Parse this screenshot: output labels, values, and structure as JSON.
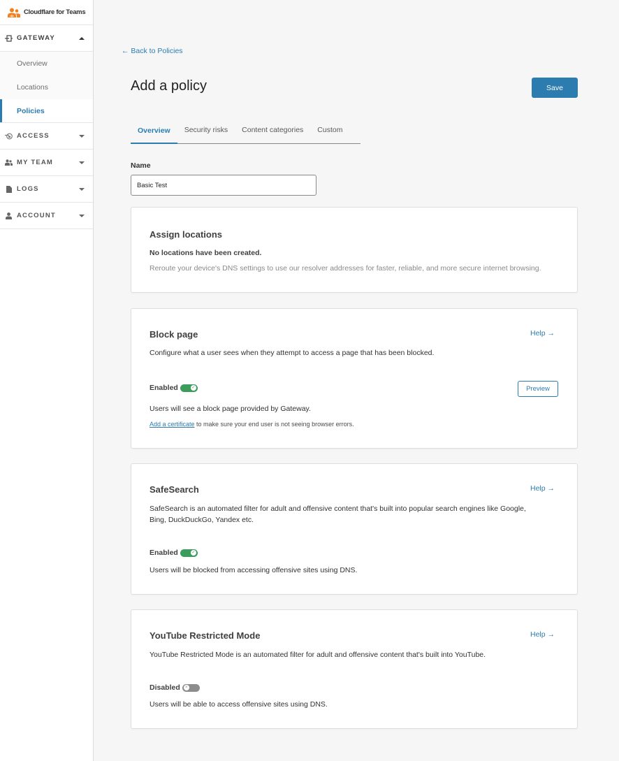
{
  "brand": {
    "name": "Cloudflare for Teams",
    "accent": "#f38020"
  },
  "sidebar": {
    "sections": [
      {
        "key": "gateway",
        "label": "GATEWAY",
        "icon": "gateway-icon",
        "expanded": true,
        "items": [
          {
            "label": "Overview",
            "active": false
          },
          {
            "label": "Locations",
            "active": false
          },
          {
            "label": "Policies",
            "active": true
          }
        ]
      },
      {
        "key": "access",
        "label": "ACCESS",
        "icon": "access-icon",
        "expanded": false
      },
      {
        "key": "my-team",
        "label": "MY TEAM",
        "icon": "team-icon",
        "expanded": false
      },
      {
        "key": "logs",
        "label": "LOGS",
        "icon": "document-icon",
        "expanded": false
      },
      {
        "key": "account",
        "label": "ACCOUNT",
        "icon": "user-icon",
        "expanded": false
      }
    ]
  },
  "header": {
    "back_link": "Back to Policies",
    "title": "Add a policy",
    "save_label": "Save"
  },
  "tabs": [
    {
      "label": "Overview",
      "active": true
    },
    {
      "label": "Security risks",
      "active": false
    },
    {
      "label": "Content categories",
      "active": false
    },
    {
      "label": "Custom",
      "active": false
    }
  ],
  "name_field": {
    "label": "Name",
    "value": "Basic Test"
  },
  "cards": {
    "assign_locations": {
      "title": "Assign locations",
      "subtitle": "No locations have been created.",
      "description": "Reroute your device's DNS settings to use our resolver addresses for faster, reliable, and more secure internet browsing."
    },
    "block_page": {
      "title": "Block page",
      "help": "Help →",
      "description": "Configure what a user sees when they attempt to access a page that has been blocked.",
      "status": "Enabled",
      "enabled": true,
      "preview_label": "Preview",
      "note": "Users will see a block page provided by Gateway.",
      "cert_link": "Add a certificate",
      "cert_text": " to make sure your end user is not seeing browser errors."
    },
    "safesearch": {
      "title": "SafeSearch",
      "help": "Help →",
      "description_line1": "SafeSearch is an automated filter for adult and offensive content that's built into popular search engines like Google,",
      "description_line2": "Bing, DuckDuckGo, Yandex etc.",
      "status": "Enabled",
      "enabled": true,
      "note": "Users will be blocked from accessing offensive sites using DNS."
    },
    "youtube": {
      "title": "YouTube Restricted Mode",
      "help": "Help →",
      "description": "YouTube Restricted Mode is an automated filter for adult and offensive content that's built into YouTube.",
      "status": "Disabled",
      "enabled": false,
      "note": "Users will be able to access offensive sites using DNS."
    }
  },
  "colors": {
    "primary": "#2c7cb0",
    "toggle_on": "#3b9c5c",
    "toggle_off": "#8d8d8d"
  }
}
